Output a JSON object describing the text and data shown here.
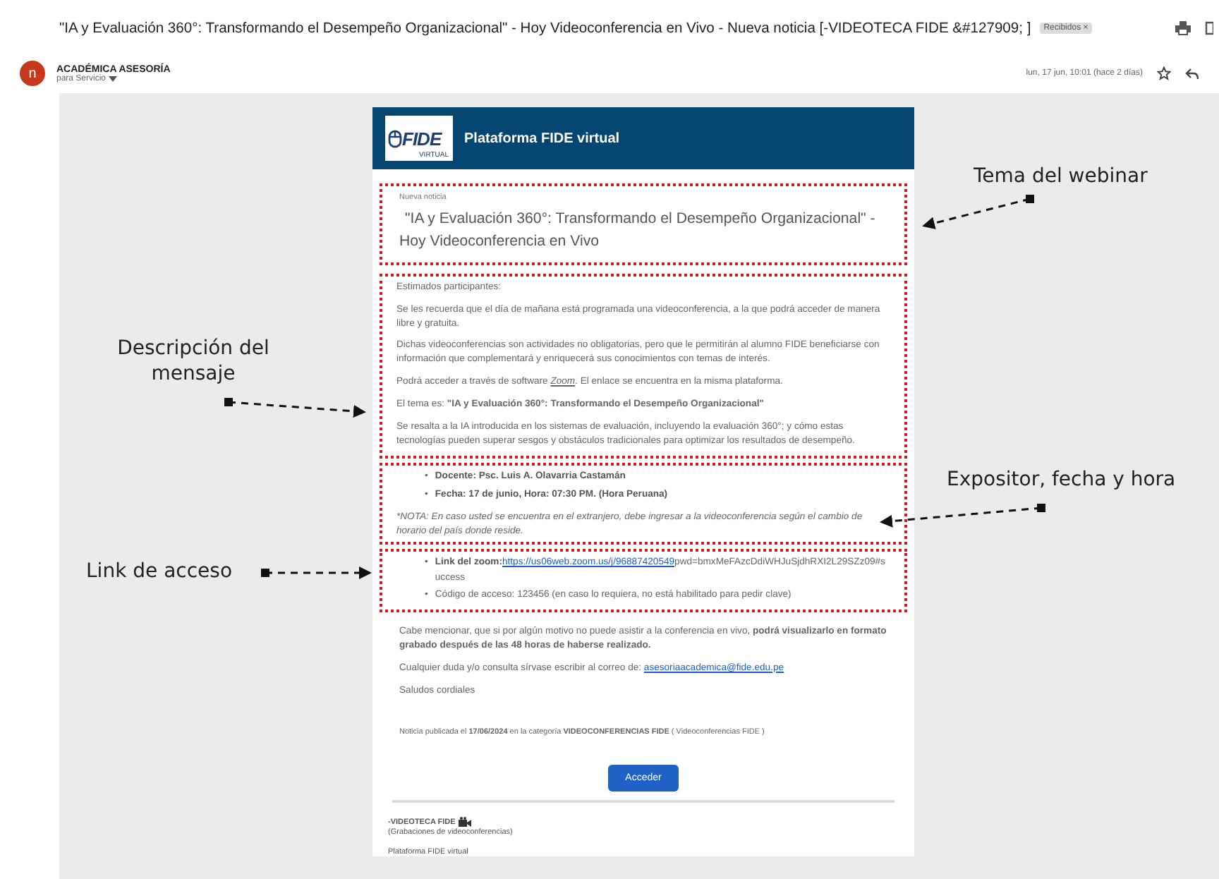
{
  "email": {
    "subject": "\"IA y Evaluación 360°: Transformando el Desempeño Organizacional\" - Hoy Videoconferencia en Vivo - Nueva noticia [-VIDEOTECA FIDE &#127909; ]",
    "label": "Recibidos",
    "label_close": "×",
    "avatar_letter": "n",
    "sender": "ACADÉMICA ASESORÍA",
    "recipient": "para Servicio",
    "date": "lun, 17 jun, 10:01 (hace 2 días)"
  },
  "newsletter": {
    "logo_text": "FIDE",
    "logo_sub": "VIRTUAL",
    "header_title": "Plataforma FIDE virtual",
    "kicker": "Nueva noticia",
    "title": "\"IA y Evaluación 360°: Transformando el Desempeño Organizacional\" - Hoy Videoconferencia en Vivo",
    "greeting": "Estimados participantes:",
    "paragraphs": [
      {
        "text": "Se les recuerda que el día de mañana está programada una videoconferencia, a la que podrá acceder de manera libre y gratuita."
      },
      {
        "text": "Dichas videoconferencias son actividades no obligatorias, pero que le permitirán al alumno FIDE beneficiarse con información que complementará y enriquecerá sus conocimientos con temas de interés."
      },
      {
        "text": "Podrá acceder a través de software ",
        "link": "Zoom",
        "after": ". El enlace se encuentra en la misma plataforma."
      },
      {
        "text": "El tema es: **\"IA y Evaluación 360°: Transformando el Desempeño Organizacional\"**"
      },
      {
        "text": "Se resalta a la IA introducida en los sistemas de evaluación, incluyendo la evaluación 360°; y cómo estas tecnologías pueden superar sesgos y obstáculos tradicionales para optimizar los resultados de desempeño."
      }
    ],
    "details": [
      {
        "bullet": "•",
        "text": "Docente: Psc. Luis A. Olavarria Castamán"
      },
      {
        "bullet": "•",
        "text": "Fecha: 17 de junio, Hora: 07:30 PM. (Hora Peruana)"
      }
    ],
    "note": "*NOTA: En caso usted se encuentra en el extranjero, debe ingresar a la videoconferencia según el cambio de horario del país donde reside.",
    "access": [
      {
        "bullet": "•",
        "label": "Link del zoom:",
        "link": "https://us06web.zoom.us/j/96887420549",
        "text": "pwd=bmxMeFAzcDdiWHJuSjdhRXI2L29SZz09#success"
      },
      {
        "bullet": "•",
        "text": "Código de acceso: 123456 (en caso lo requiera, no está habilitado para pedir clave)"
      }
    ],
    "closing": "Cabe mencionar, que si por algún motivo no puede asistir a la conferencia en vivo, **podrá visualizarlo en formato grabado después de las 48 horas de haberse realizado.**",
    "contact": {
      "text": "Cualquier duda y/o consulta sírvase escribir al correo de: ",
      "link": "asesoriaacademica@fide.edu.pe"
    },
    "regards": "Saludos cordiales",
    "published": "Noticia publicada el **17/06/2024** en la categoría **VIDEOCONFERENCIAS FIDE** ( Videoconferencias FIDE )",
    "button": "Acceder",
    "signature": {
      "name": "-VIDEOTECA FIDE",
      "subtitle": "(Grabaciones de videoconferencias)",
      "platform": "Plataforma FIDE virtual"
    }
  },
  "annotations": [
    {
      "text": "Tema del webinar"
    },
    {
      "text": "Descripción del mensaje"
    },
    {
      "text": "Expositor, fecha y hora"
    },
    {
      "text": "Link de acceso"
    }
  ]
}
